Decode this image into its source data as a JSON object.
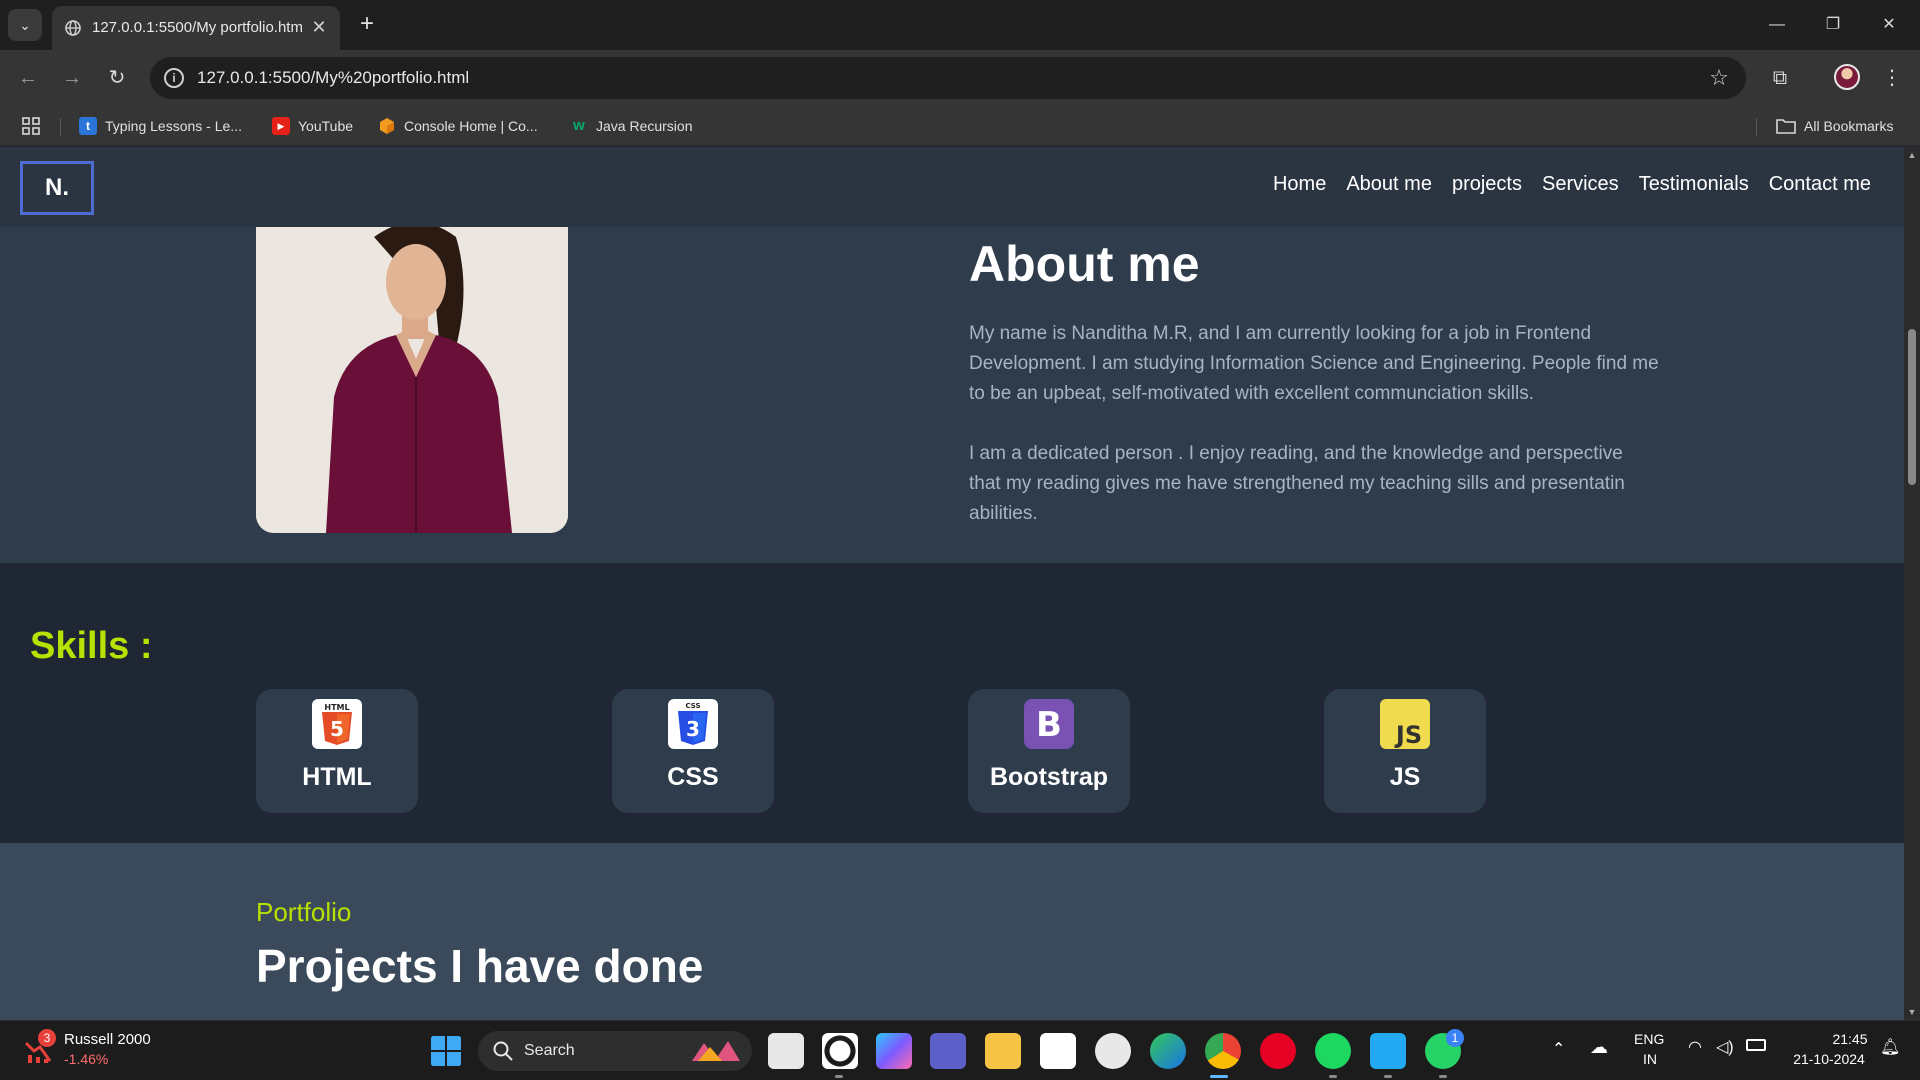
{
  "browser": {
    "tab_title": "127.0.0.1:5500/My portfolio.htm",
    "url": "127.0.0.1:5500/My%20portfolio.html",
    "bookmarks": [
      {
        "label": "Typing Lessons - Le...",
        "icon": "typing-icon",
        "color": "#2b74d8",
        "glyph": "t"
      },
      {
        "label": "YouTube",
        "icon": "youtube-icon",
        "color": "#e62117",
        "glyph": "▶"
      },
      {
        "label": "Console Home | Co...",
        "icon": "aws-cube-icon",
        "color": "#f29a1d",
        "glyph": ""
      },
      {
        "label": "Java Recursion",
        "icon": "w3schools-icon",
        "color": "#04aa6d",
        "glyph": "w"
      }
    ],
    "all_bookmarks_label": "All Bookmarks"
  },
  "site": {
    "logo": "N.",
    "nav": [
      "Home",
      "About me",
      "projects",
      "Services",
      "Testimonials",
      "Contact me"
    ],
    "about": {
      "title": "About me",
      "para1": "My name is Nanditha M.R, and I am currently looking for a job in Frontend Development. I am studying Information Science and Engineering. People find me to be an upbeat, self-motivated with excellent communciation skills.",
      "para2": "I am a dedicated person . I enjoy reading, and the knowledge and perspective that my reading gives me have strengthened my teaching sills and presentatin abilities."
    },
    "skills": {
      "title": "Skills :",
      "items": [
        {
          "label": "HTML",
          "icon": "html5-icon",
          "badge": "HTML",
          "color": "#e34c26"
        },
        {
          "label": "CSS",
          "icon": "css3-icon",
          "badge": "CSS",
          "color": "#264de4"
        },
        {
          "label": "Bootstrap",
          "icon": "bootstrap-icon",
          "badge": "B",
          "color": "#7952b3"
        },
        {
          "label": "JS",
          "icon": "javascript-icon",
          "badge": "JS",
          "color": "#f0db4f"
        }
      ]
    },
    "portfolio": {
      "eyebrow": "Portfolio",
      "title": "Projects I have done"
    },
    "colors": {
      "accent": "#b8e000",
      "nav_bg": "#2b3542",
      "about_bg": "#2f3c4c",
      "skills_bg": "#1e2733",
      "portfolio_bg": "#3b4a5b"
    }
  },
  "taskbar": {
    "stock_name": "Russell 2000",
    "stock_change": "-1.46%",
    "stock_badge": "3",
    "search_label": "Search",
    "lang_top": "ENG",
    "lang_bottom": "IN",
    "time": "21:45",
    "date": "21-10-2024",
    "whatsapp_badge": "1"
  }
}
